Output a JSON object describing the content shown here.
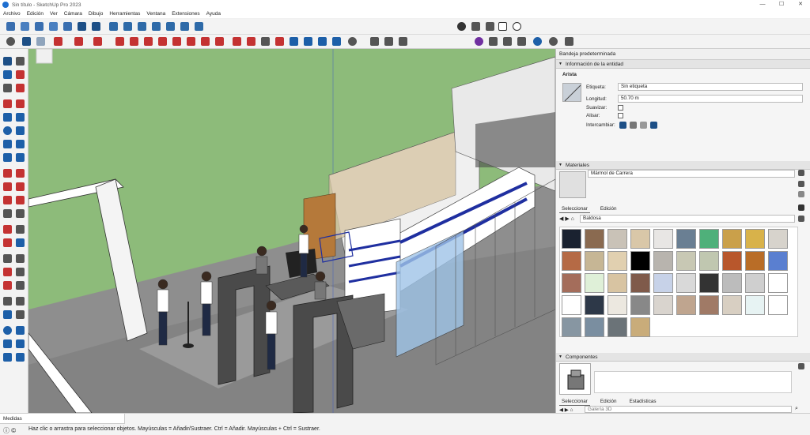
{
  "window": {
    "title": "Sin título - SketchUp Pro 2023"
  },
  "menu": [
    "Archivo",
    "Edición",
    "Ver",
    "Cámara",
    "Dibujo",
    "Herramientas",
    "Ventana",
    "Extensiones",
    "Ayuda"
  ],
  "tray": {
    "title": "Bandeja predeterminada",
    "entity": {
      "header": "Información de la entidad",
      "type": "Arista",
      "label_lbl": "Etiqueta:",
      "label_val": "Sin etiqueta",
      "length_lbl": "Longitud:",
      "length_val": "50.70 m",
      "soften_lbl": "Suavizar:",
      "smooth_lbl": "Alisar:",
      "swap_lbl": "Intercambiar:"
    },
    "materials": {
      "header": "Materiales",
      "current": "Mármol de Carrera",
      "tab_select": "Seleccionar",
      "tab_edit": "Edición",
      "library": "Baldosa",
      "swatch_colors": [
        "#1a2230",
        "#8a6a50",
        "#c9c2b7",
        "#d9c7a8",
        "#e8e6e4",
        "#6a7f93",
        "#4fb07a",
        "#caa04a",
        "#d8b24a",
        "#d7d3cc",
        "#b56a45",
        "#c6b695",
        "#e1d0b0",
        "#000000",
        "#b8b4ae",
        "#c8c8b4",
        "#c0c7b0",
        "#b8572c",
        "#b96d27",
        "#5a7fd0",
        "#a46d5b",
        "#dff0d8",
        "#d8c4a2",
        "#7f5a4a",
        "#c7d2e8",
        "#d9d9d9",
        "#333333",
        "#bcbcbc",
        "#cfcfcf",
        "#ffffff",
        "#ffffff",
        "#2d3848",
        "#ece8e0",
        "#888888",
        "#d9d4ce",
        "#bfa58f",
        "#a07a66",
        "#d8cfc2",
        "#e7f3f3",
        "#ffffff",
        "#8796a2",
        "#7a8ea0",
        "#6b7378",
        "#c9ac7a"
      ]
    },
    "components": {
      "header": "Componentes",
      "tab_select": "Seleccionar",
      "tab_edit": "Edición",
      "tab_stats": "Estadísticas",
      "search_placeholder": "Galería 3D"
    }
  },
  "status": {
    "measure_label": "Medidas",
    "hint": "Haz clic o arrastra para seleccionar objetos. Mayúsculas = Añadir/Sustraer. Ctrl = Añadir. Mayúsculas + Ctrl = Sustraer."
  }
}
